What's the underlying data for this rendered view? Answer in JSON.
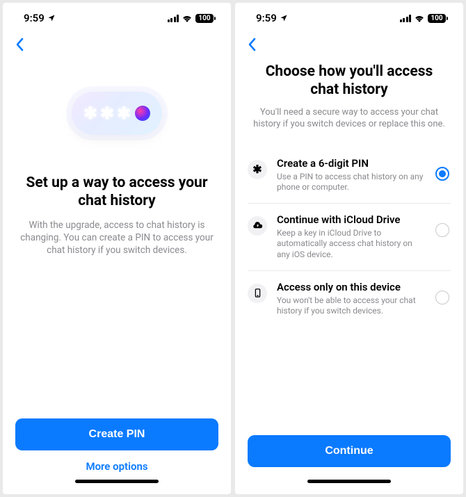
{
  "status": {
    "time": "9:59",
    "battery": "100"
  },
  "screen1": {
    "title": "Set up a way to access your chat history",
    "subtitle": "With the upgrade, access to chat history is changing. You can create a PIN to access your chat history if you switch devices.",
    "primary": "Create PIN",
    "secondary": "More options"
  },
  "screen2": {
    "title": "Choose how you'll access chat history",
    "subtitle": "You'll need a secure way to access your chat history if you switch devices or replace this one.",
    "options": [
      {
        "title": "Create a 6-digit PIN",
        "desc": "Use a PIN to access chat history on any phone or computer.",
        "selected": true
      },
      {
        "title": "Continue with iCloud Drive",
        "desc": "Keep a key in iCloud Drive to automatically access chat history on any iOS device.",
        "selected": false
      },
      {
        "title": "Access only on this device",
        "desc": "You won't be able to access your chat history if you switch devices.",
        "selected": false
      }
    ],
    "primary": "Continue"
  }
}
